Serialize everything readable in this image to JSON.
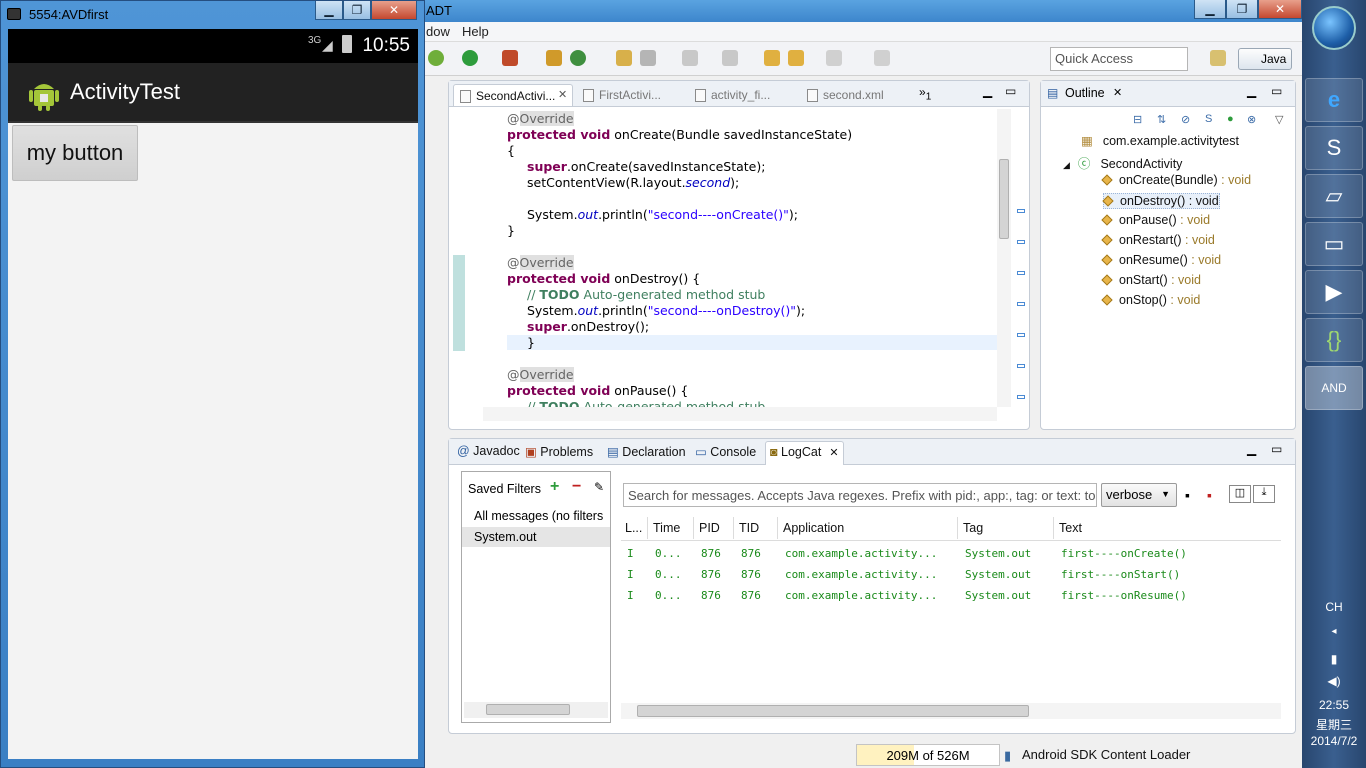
{
  "adt": {
    "title": "ADT",
    "menu": [
      "dow",
      "Help"
    ],
    "quick_access_placeholder": "Quick Access",
    "perspective": "Java"
  },
  "editor": {
    "tabs": [
      {
        "label": "SecondActivi...",
        "active": true
      },
      {
        "label": "FirstActivi...",
        "active": false
      },
      {
        "label": "activity_fi...",
        "active": false
      },
      {
        "label": "second.xml",
        "active": false
      }
    ],
    "overflow_count": "1",
    "lines": [
      {
        "indent": 0,
        "parts": [
          {
            "t": "@",
            "c": "ann0"
          },
          {
            "t": "Override",
            "c": "ann"
          }
        ]
      },
      {
        "indent": 0,
        "parts": [
          {
            "t": "protected void",
            "c": "kw"
          },
          {
            "t": " onCreate(Bundle savedInstanceState)",
            "c": ""
          }
        ]
      },
      {
        "indent": 0,
        "parts": [
          {
            "t": "{",
            "c": ""
          }
        ]
      },
      {
        "indent": 1,
        "parts": [
          {
            "t": "super",
            "c": "kw"
          },
          {
            "t": ".onCreate(savedInstanceState);",
            "c": ""
          }
        ]
      },
      {
        "indent": 1,
        "parts": [
          {
            "t": "setContentView(R.layout.",
            "c": ""
          },
          {
            "t": "second",
            "c": "ital"
          },
          {
            "t": ");",
            "c": ""
          }
        ]
      },
      {
        "indent": 0,
        "parts": []
      },
      {
        "indent": 1,
        "parts": [
          {
            "t": "System.",
            "c": ""
          },
          {
            "t": "out",
            "c": "ital"
          },
          {
            "t": ".println(",
            "c": ""
          },
          {
            "t": "\"second----onCreate()\"",
            "c": "str"
          },
          {
            "t": ");",
            "c": ""
          }
        ]
      },
      {
        "indent": 0,
        "parts": [
          {
            "t": "}",
            "c": ""
          }
        ]
      },
      {
        "indent": 0,
        "parts": []
      },
      {
        "indent": 0,
        "parts": [
          {
            "t": "@",
            "c": "ann0"
          },
          {
            "t": "Override",
            "c": "ann"
          }
        ]
      },
      {
        "indent": 0,
        "parts": [
          {
            "t": "protected void",
            "c": "kw"
          },
          {
            "t": " onDestroy() {",
            "c": ""
          }
        ]
      },
      {
        "indent": 1,
        "parts": [
          {
            "t": "// ",
            "c": "cmt"
          },
          {
            "t": "TODO",
            "c": "cmt kw"
          },
          {
            "t": " Auto-generated method stub",
            "c": "cmt"
          }
        ]
      },
      {
        "indent": 1,
        "parts": [
          {
            "t": "System.",
            "c": ""
          },
          {
            "t": "out",
            "c": "ital"
          },
          {
            "t": ".println(",
            "c": ""
          },
          {
            "t": "\"second----onDestroy()\"",
            "c": "str"
          },
          {
            "t": ");",
            "c": ""
          }
        ]
      },
      {
        "indent": 1,
        "parts": [
          {
            "t": "super",
            "c": "kw"
          },
          {
            "t": ".onDestroy();",
            "c": ""
          }
        ]
      },
      {
        "indent": 0,
        "parts": [
          {
            "t": "}",
            "c": ""
          }
        ]
      },
      {
        "indent": 0,
        "parts": []
      },
      {
        "indent": 0,
        "parts": [
          {
            "t": "@",
            "c": "ann0"
          },
          {
            "t": "Override",
            "c": "ann"
          }
        ]
      },
      {
        "indent": 0,
        "parts": [
          {
            "t": "protected void",
            "c": "kw"
          },
          {
            "t": " onPause() {",
            "c": ""
          }
        ]
      },
      {
        "indent": 1,
        "parts": [
          {
            "t": "// ",
            "c": "cmt"
          },
          {
            "t": "TODO",
            "c": "cmt kw"
          },
          {
            "t": " Auto-generated method stub",
            "c": "cmt"
          }
        ]
      }
    ]
  },
  "outline": {
    "tab": "Outline",
    "package": "com.example.activitytest",
    "class": "SecondActivity",
    "methods": [
      {
        "name": "onCreate(Bundle)",
        "type": " : void"
      },
      {
        "name": "onDestroy()",
        "type": " : void"
      },
      {
        "name": "onPause()",
        "type": " : void"
      },
      {
        "name": "onRestart()",
        "type": " : void"
      },
      {
        "name": "onResume()",
        "type": " : void"
      },
      {
        "name": "onStart()",
        "type": " : void"
      },
      {
        "name": "onStop()",
        "type": " : void"
      }
    ]
  },
  "bottom": {
    "tabs": [
      "Javadoc",
      "Problems",
      "Declaration",
      "Console",
      "LogCat"
    ],
    "saved_filters_label": "Saved Filters",
    "filters": [
      "All messages (no filters",
      "System.out"
    ],
    "search_placeholder": "Search for messages. Accepts Java regexes. Prefix with pid:, app:, tag: or text: to",
    "level": "verbose",
    "columns": [
      "L...",
      "Time",
      "PID",
      "TID",
      "Application",
      "Tag",
      "Text"
    ],
    "rows": [
      [
        "I",
        "0...",
        "876",
        "876",
        "com.example.activity...",
        "System.out",
        "first----onCreate()"
      ],
      [
        "I",
        "0...",
        "876",
        "876",
        "com.example.activity...",
        "System.out",
        "first----onStart()"
      ],
      [
        "I",
        "0...",
        "876",
        "876",
        "com.example.activity...",
        "System.out",
        "first----onResume()"
      ]
    ]
  },
  "statusbar": {
    "heap": "209M of 526M",
    "task": "Android SDK Content Loader"
  },
  "emulator": {
    "title": "5554:AVDfirst",
    "clock": "10:55",
    "network": "3G",
    "app_title": "ActivityTest",
    "button_label": "my button"
  },
  "taskbar": {
    "lang": "CH",
    "time": "22:55",
    "weekday": "星期三",
    "date": "2014/7/2"
  }
}
